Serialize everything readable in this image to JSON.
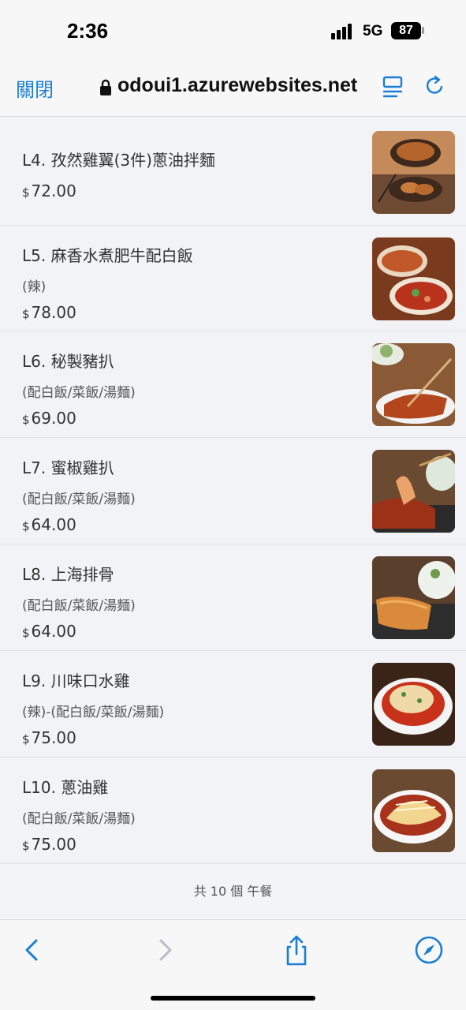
{
  "status": {
    "time": "2:36",
    "network": "5G",
    "battery": "87"
  },
  "browser": {
    "close_label": "關閉",
    "url": "odoui1.azurewebsites.net"
  },
  "menu": {
    "currency": "$",
    "items": [
      {
        "name": "L4. 孜然雞翼(3件)蔥油拌麵",
        "note": "",
        "price": "72.00"
      },
      {
        "name": "L5. 麻香水煮肥牛配白飯",
        "note": "(辣)",
        "price": "78.00"
      },
      {
        "name": "L6. 秘製豬扒",
        "note": "(配白飯/菜飯/湯麵)",
        "price": "69.00"
      },
      {
        "name": "L7. 蜜椒雞扒",
        "note": "(配白飯/菜飯/湯麵)",
        "price": "64.00"
      },
      {
        "name": "L8. 上海排骨",
        "note": "(配白飯/菜飯/湯麵)",
        "price": "64.00"
      },
      {
        "name": "L9. 川味口水雞",
        "note": "(辣)-(配白飯/菜飯/湯麵)",
        "price": "75.00"
      },
      {
        "name": "L10. 蔥油雞",
        "note": "(配白飯/菜飯/湯麵)",
        "price": "75.00"
      }
    ],
    "footer": "共 10 個 午餐"
  },
  "toolbar": {
    "back_icon": "chevron-left-icon",
    "forward_icon": "chevron-right-icon",
    "share_icon": "share-icon",
    "safari_icon": "compass-icon"
  },
  "colors": {
    "accent": "#1a7fd4",
    "background": "#f1f3f6"
  }
}
